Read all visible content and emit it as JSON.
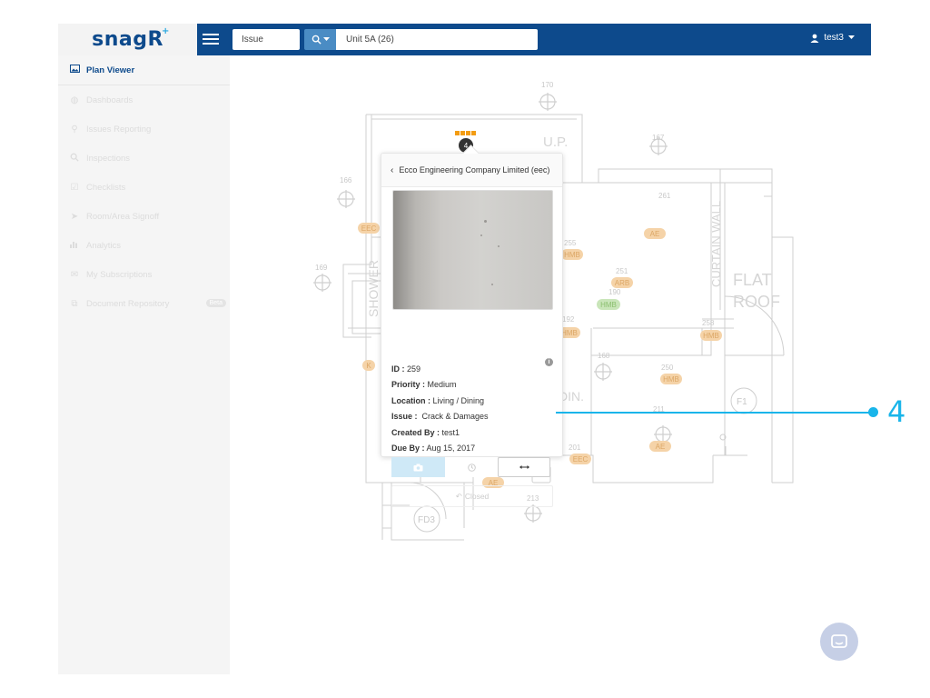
{
  "app": {
    "logo_text": "snagR",
    "logo_mark": "+"
  },
  "topbar": {
    "type_value": "Issue",
    "search_icon": "search-icon",
    "search_value": "Unit 5A (26)",
    "user_name": "test3"
  },
  "sidebar": {
    "items": [
      {
        "label": "Plan Viewer",
        "icon": "image-icon",
        "active": true
      },
      {
        "label": "Dashboards",
        "icon": "palette-icon"
      },
      {
        "label": "Issues Reporting",
        "icon": "map-pin-icon"
      },
      {
        "label": "Inspections",
        "icon": "search-icon"
      },
      {
        "label": "Checklists",
        "icon": "checkbox-icon"
      },
      {
        "label": "Room/Area Signoff",
        "icon": "send-icon"
      },
      {
        "label": "Analytics",
        "icon": "bar-chart-icon"
      },
      {
        "label": "My Subscriptions",
        "icon": "envelope-icon"
      },
      {
        "label": "Document Repository",
        "icon": "document-icon",
        "badge": "Beta"
      }
    ]
  },
  "plan": {
    "room_labels": [
      "U.P.",
      "SHOWER",
      "CURTAIN WALL",
      "FLAT",
      "ROOF",
      "DIN.",
      "F1",
      "FD3"
    ],
    "markers": [
      "170",
      "167",
      "166",
      "169",
      "168",
      "213",
      "261",
      "251",
      "255",
      "190",
      "192",
      "258",
      "250",
      "201",
      "211"
    ],
    "tags": [
      "EEC",
      "HMB",
      "ARB",
      "HMB",
      "AE",
      "HMB",
      "HMB",
      "HMB",
      "AE",
      "EEC",
      "AE",
      "K"
    ],
    "pin_count": "4"
  },
  "popup": {
    "header": "Ecco Engineering Company Limited (eec)",
    "id_label": "ID :",
    "id_value": "259",
    "priority_label": "Priority :",
    "priority_value": "Medium",
    "location_label": "Location :",
    "location_value": "Living / Dining",
    "issue_label": "Issue :",
    "issue_value": "Crack & Damages",
    "created_label": "Created By :",
    "created_value": "test1",
    "due_label": "Due By :",
    "due_value": "Aug 15, 2017",
    "closed_label": "Closed"
  },
  "callout": {
    "number": "4"
  },
  "colors": {
    "brand": "#0d4a8c",
    "accent": "#29a8e0",
    "callout": "#19b5ea",
    "tag_orange": "#f5d3a8",
    "tag_green": "#c9e5b9",
    "pin_orange": "#f39c12"
  }
}
